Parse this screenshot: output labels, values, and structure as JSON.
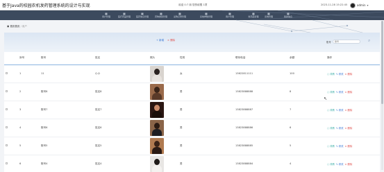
{
  "header": {
    "title": "基于Java的校园农机发药管理系统的设计与实现",
    "mid_text": "欢迎 0:7  用 您的权限 1项",
    "datetime": "2023-11-28 15:22:45",
    "user": "admin"
  },
  "nav": {
    "items": [
      {
        "label": "用户管理",
        "icon": "grid-icon"
      },
      {
        "label": "医疗药品管理",
        "icon": "grid-icon"
      },
      {
        "label": "医药信息管理",
        "icon": "grid-icon"
      },
      {
        "label": "药物类别管理",
        "icon": "grid-icon"
      },
      {
        "label": "采购记录管理",
        "icon": "grid-icon"
      },
      {
        "label": "系统参数管理",
        "icon": "grid-icon"
      },
      {
        "label": "用户管理",
        "icon": "grid-icon"
      },
      {
        "label": "新药品管理",
        "icon": "grid-icon"
      },
      {
        "label": "系统管理",
        "icon": "grid-icon"
      },
      {
        "label": "我的信息",
        "icon": "grid-icon"
      }
    ]
  },
  "breadcrumb": {
    "home": "首页首页",
    "separator": "/",
    "current": "用户"
  },
  "actions": {
    "add": "+ 新增",
    "delete": "× 删除"
  },
  "search": {
    "label": "账号",
    "placeholder": "账号",
    "button_icon": "search-icon"
  },
  "table": {
    "columns": [
      "",
      "序号",
      "账号",
      "姓名",
      "照片",
      "性别",
      "联系电话",
      "余额",
      "操作"
    ],
    "rows": [
      {
        "index": "1",
        "account": "11",
        "name": "小小",
        "gender": "女",
        "phone": "13622811111",
        "balance": "100"
      },
      {
        "index": "2",
        "account": "账号8",
        "name": "姓名8",
        "gender": "男",
        "phone": "13823888888",
        "balance": "8"
      },
      {
        "index": "3",
        "account": "账号7",
        "name": "姓名7",
        "gender": "男",
        "phone": "13823888887",
        "balance": "7"
      },
      {
        "index": "4",
        "account": "账号6",
        "name": "姓名6",
        "gender": "男",
        "phone": "13823888886",
        "balance": "6"
      },
      {
        "index": "5",
        "account": "账号5",
        "name": "姓名5",
        "gender": "男",
        "phone": "13823888885",
        "balance": "5"
      },
      {
        "index": "6",
        "account": "账号4",
        "name": "姓名4",
        "gender": "男",
        "phone": "13823888884",
        "balance": "4"
      }
    ],
    "row_actions": {
      "detail": "○ 详情",
      "edit": "✎ 修改",
      "delete": "× 删除"
    }
  },
  "colors": {
    "nav_bg": "#3c4a5e",
    "accent_blue": "#3d7bd6",
    "danger": "#e0504c",
    "teal": "#2ea8a0"
  }
}
